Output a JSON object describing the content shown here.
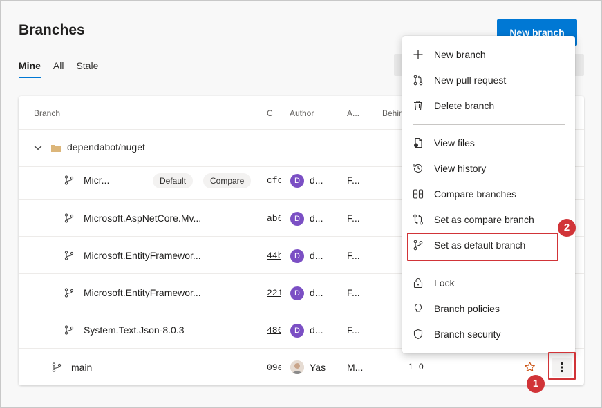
{
  "page": {
    "title": "Branches",
    "new_branch_label": "New branch"
  },
  "tabs": [
    {
      "label": "Mine",
      "active": true
    },
    {
      "label": "All",
      "active": false
    },
    {
      "label": "Stale",
      "active": false
    }
  ],
  "table": {
    "headers": {
      "branch": "Branch",
      "commit": "C",
      "author": "Author",
      "authored": "A...",
      "behind": "Behind"
    },
    "folder": {
      "name": "dependabot/nuget"
    },
    "rows": [
      {
        "name": "Micr...",
        "commit": "cfc",
        "avatar": "D",
        "author": "d...",
        "authored": "F...",
        "chips": [
          "Default",
          "Compare"
        ]
      },
      {
        "name": "Microsoft.AspNetCore.Mv...",
        "commit": "ab6",
        "avatar": "D",
        "author": "d...",
        "authored": "F..."
      },
      {
        "name": "Microsoft.EntityFramewor...",
        "commit": "44b",
        "avatar": "D",
        "author": "d...",
        "authored": "F..."
      },
      {
        "name": "Microsoft.EntityFramewor...",
        "commit": "221",
        "avatar": "D",
        "author": "d...",
        "authored": "F..."
      },
      {
        "name": "System.Text.Json-8.0.3",
        "commit": "486",
        "avatar": "D",
        "author": "d...",
        "authored": "F..."
      }
    ],
    "main_row": {
      "name": "main",
      "commit": "09e",
      "author": "Yas",
      "authored": "M...",
      "behind": "1",
      "ahead": "0"
    }
  },
  "menu": {
    "items": [
      {
        "label": "New branch",
        "icon": "plus-icon"
      },
      {
        "label": "New pull request",
        "icon": "pull-request-icon"
      },
      {
        "label": "Delete branch",
        "icon": "trash-icon"
      },
      {
        "label": "View files",
        "icon": "file-icon"
      },
      {
        "label": "View history",
        "icon": "history-icon"
      },
      {
        "label": "Compare branches",
        "icon": "compare-icon"
      },
      {
        "label": "Set as compare branch",
        "icon": "compare-branch-icon"
      },
      {
        "label": "Set as default branch",
        "icon": "branch-icon"
      },
      {
        "label": "Lock",
        "icon": "lock-icon"
      },
      {
        "label": "Branch policies",
        "icon": "policy-icon"
      },
      {
        "label": "Branch security",
        "icon": "shield-icon"
      }
    ]
  },
  "callouts": {
    "step1": "1",
    "step2": "2"
  },
  "colors": {
    "accent": "#0078d4",
    "callout": "#d13438",
    "avatar": "#7b4fc4",
    "star": "#ca5010"
  }
}
